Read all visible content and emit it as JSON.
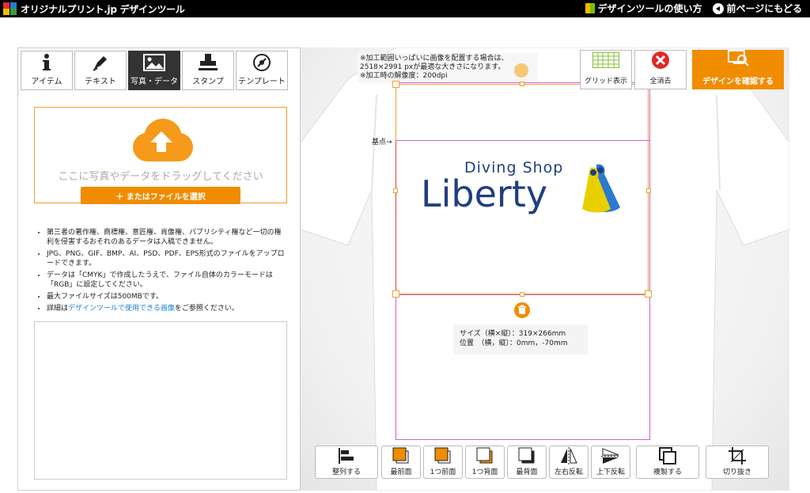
{
  "header": {
    "logo_text": "オリジナルプリント.jp  デザインツール",
    "nav_help": "デザインツールの使い方",
    "nav_back": "前ページにもどる"
  },
  "tabs": [
    {
      "label": "アイテム",
      "icon": "info-icon"
    },
    {
      "label": "テキスト",
      "icon": "pen-icon"
    },
    {
      "label": "写真・データ",
      "icon": "image-icon",
      "active": true
    },
    {
      "label": "スタンプ",
      "icon": "stamp-icon"
    },
    {
      "label": "テンプレート",
      "icon": "template-icon"
    }
  ],
  "upload": {
    "drop_text": "ここに写真やデータをドラッグしてください",
    "file_button": "＋ またはファイルを選択"
  },
  "notes": {
    "n1": "第三者の著作権、商標権、意匠権、肖像権、パブリシティ権など一切の権利を侵害するおそれのあるデータは入稿できません。",
    "n2": "JPG、PNG、GIF、BMP、AI、PSD、PDF、EPS形式のファイルをアップロードできます。",
    "n3": "データは「CMYK」で作成したうえで、ファイル自体のカラーモードは「RGB」に設定してください。",
    "n4": "最大ファイルサイズは500MBです。",
    "n5_pre": "詳細は",
    "n5_link": "デザインツールで使用できる画像",
    "n5_post": "をご参照ください。"
  },
  "canvas": {
    "info_line1": "※加工範囲いっぱいに画像を配置する場合は、",
    "info_line2": "2518×2991 pxが最適な大きさになります。",
    "info_line3": "※加工時の解像度：200dpi",
    "kiten": "基点→",
    "logo_sub": "Diving  Shop",
    "logo_main": "Liberty",
    "size_line": "サイズ（横×縦）：319×266mm",
    "pos_line": "位置　（横，縦）：0mm，-70mm"
  },
  "top_tools": {
    "grid": "グリッド表示",
    "clear": "全消去",
    "confirm": "デザインを確認する"
  },
  "bottom_tools": [
    "整列する",
    "最前面",
    "1つ前面",
    "1つ背面",
    "最背面",
    "左右反転",
    "上下反転",
    "複製する",
    "切り抜き"
  ],
  "colors": {
    "accent": "#f08c00",
    "logo_blue": "#1f3f7f",
    "selection_border": "#f0a030",
    "guide_border": "#d060d0"
  }
}
